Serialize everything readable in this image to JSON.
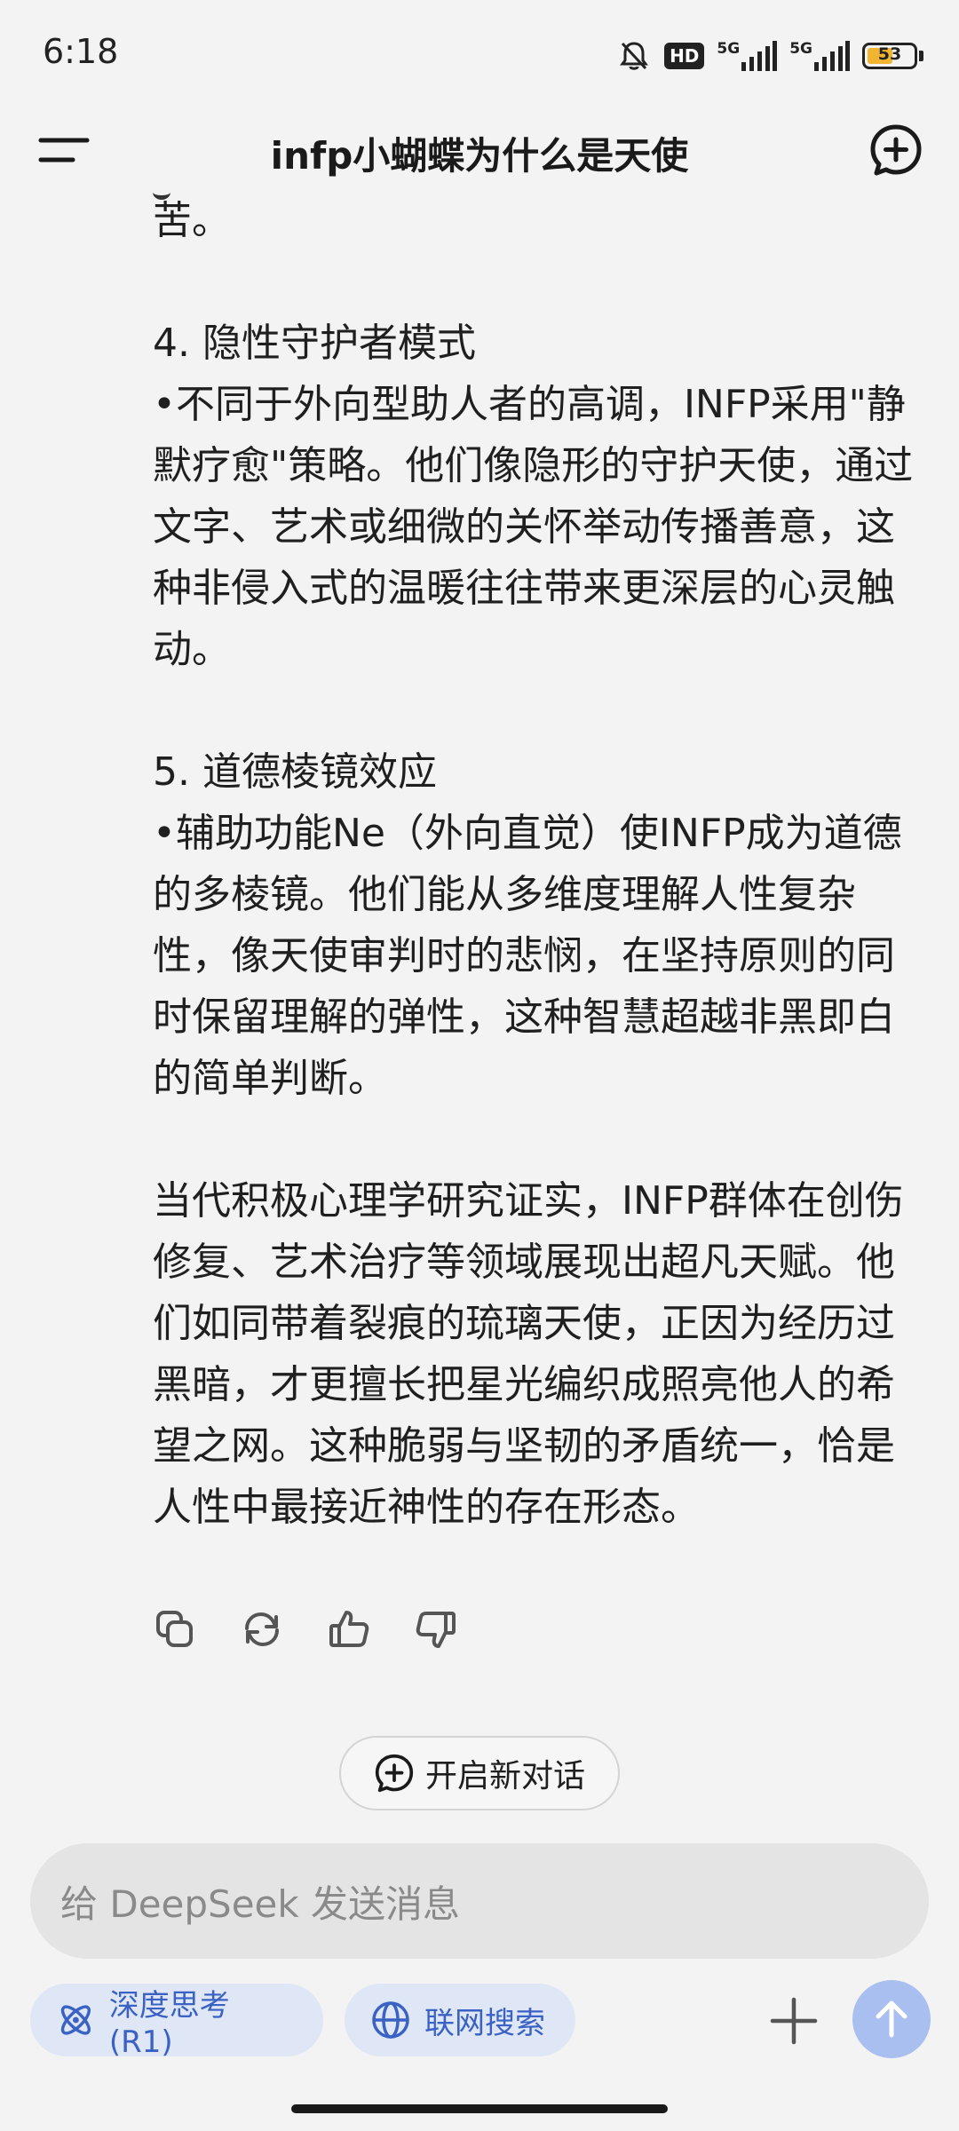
{
  "status_bar": {
    "time": "6:18",
    "hd_label": "HD",
    "network_1": "5G",
    "network_2": "5G",
    "battery": "53"
  },
  "header": {
    "title": "infp小蝴蝶为什么是天使"
  },
  "message": {
    "paragraphs": [
      "苦。",
      "",
      "4. 隐性守护者模式",
      "•不同于外向型助人者的高调，INFP采用\"静默疗愈\"策略。他们像隐形的守护天使，通过文字、艺术或细微的关怀举动传播善意，这种非侵入式的温暖往往带来更深层的心灵触动。",
      "",
      "5. 道德棱镜效应",
      "•辅助功能Ne（外向直觉）使INFP成为道德的多棱镜。他们能从多维度理解人性复杂性，像天使审判时的悲悯，在坚持原则的同时保留理解的弹性，这种智慧超越非黑即白的简单判断。",
      "",
      "当代积极心理学研究证实，INFP群体在创伤修复、艺术治疗等领域展现出超凡天赋。他们如同带着裂痕的琉璃天使，正因为经历过黑暗，才更擅长把星光编织成照亮他人的希望之网。这种脆弱与坚韧的矛盾统一，恰是人性中最接近神性的存在形态。"
    ]
  },
  "actions": {
    "icons": [
      "copy-icon",
      "refresh-icon",
      "thumbs-up-icon",
      "thumbs-down-icon"
    ]
  },
  "new_conversation": {
    "label": "开启新对话"
  },
  "input": {
    "placeholder": "给 DeepSeek 发送消息"
  },
  "chips": {
    "deep_think": "深度思考 (R1)",
    "web_search": "联网搜索"
  },
  "colors": {
    "accent": "#3a62c4",
    "chip_bg": "#dfe6f5",
    "send_bg": "#a9bff0",
    "battery": "#f2b531"
  }
}
